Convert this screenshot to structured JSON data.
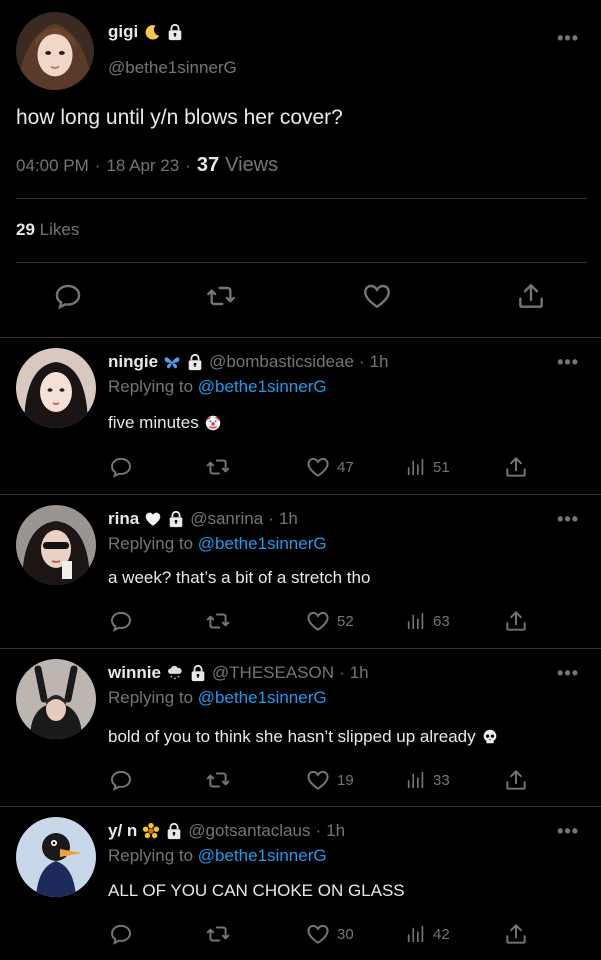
{
  "main": {
    "name": "gigi",
    "handle": "@bethe1sinnerG",
    "text": "how long until y/n blows her cover?",
    "time": "04:00 PM",
    "date": "18 Apr 23",
    "views_count": "37",
    "views_label": "Views",
    "likes_count": "29",
    "likes_label": "Likes",
    "more": "•••",
    "sep": "·"
  },
  "replies": [
    {
      "name": "ningie",
      "handle": "@bombasticsideae",
      "time": "1h",
      "replying_label": "Replying to",
      "replying_handle": "@bethe1sinnerG",
      "text": "five minutes",
      "likes": "47",
      "views": "51",
      "sep": "·",
      "more": "•••"
    },
    {
      "name": "rina",
      "handle": "@sanrina",
      "time": "1h",
      "replying_label": "Replying to",
      "replying_handle": "@bethe1sinnerG",
      "text": "a week? that’s a bit of a stretch tho",
      "likes": "52",
      "views": "63",
      "sep": "·",
      "more": "•••"
    },
    {
      "name": "winnie",
      "handle": "@THESEASON",
      "time": "1h",
      "replying_label": "Replying to",
      "replying_handle": "@bethe1sinnerG",
      "text": "bold of you to think she hasn’t slipped up already",
      "likes": "19",
      "views": "33",
      "sep": "·",
      "more": "•••"
    },
    {
      "name": "y/ n",
      "handle": "@gotsantaclaus",
      "time": "1h",
      "replying_label": "Replying to",
      "replying_handle": "@bethe1sinnerG",
      "text": "ALL OF YOU CAN CHOKE ON GLASS",
      "likes": "30",
      "views": "42",
      "sep": "·",
      "more": "•••"
    }
  ],
  "icons": {
    "reply": "speech-bubble-icon",
    "retweet": "retweet-icon",
    "like": "heart-icon",
    "views": "bar-chart-icon",
    "share": "share-icon",
    "lock": "lock-icon",
    "moon": "crescent-moon-icon",
    "butterfly": "butterfly-icon",
    "white-heart": "white-heart-icon",
    "cloud": "cloud-snow-icon",
    "flower": "flower-icon",
    "clown": "clown-face-icon",
    "skull": "skull-icon"
  },
  "colors": {
    "background": "#000000",
    "text": "#e7e9ea",
    "muted": "#71767b",
    "link": "#1d9bf0",
    "divider": "#2f3336"
  }
}
